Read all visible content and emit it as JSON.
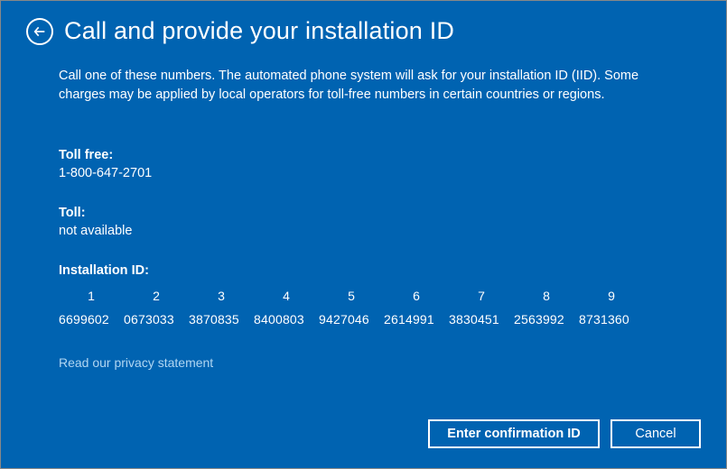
{
  "header": {
    "title": "Call and provide your installation ID"
  },
  "description": "Call one of these numbers. The automated phone system will ask for your installation ID (IID). Some charges may be applied by local operators for toll-free numbers in certain countries or regions.",
  "toll_free": {
    "label": "Toll free:",
    "value": "1-800-647-2701"
  },
  "toll": {
    "label": "Toll:",
    "value": "not available"
  },
  "installation_id": {
    "label": "Installation ID:",
    "indices": [
      "1",
      "2",
      "3",
      "4",
      "5",
      "6",
      "7",
      "8",
      "9"
    ],
    "values": [
      "6699602",
      "0673033",
      "3870835",
      "8400803",
      "9427046",
      "2614991",
      "3830451",
      "2563992",
      "8731360"
    ]
  },
  "privacy_link": "Read our privacy statement",
  "buttons": {
    "primary": "Enter confirmation ID",
    "cancel": "Cancel"
  }
}
